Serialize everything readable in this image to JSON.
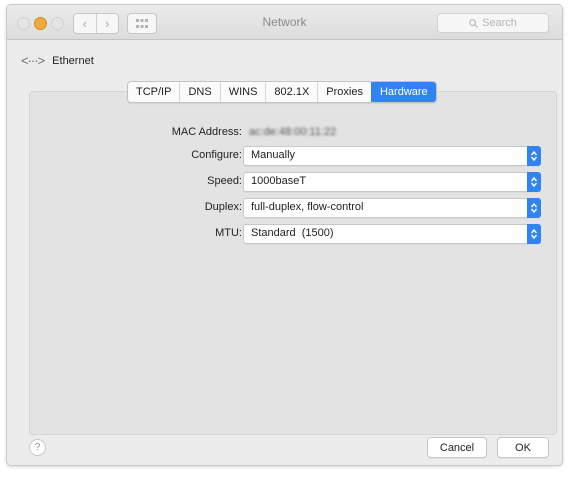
{
  "window": {
    "title": "Network"
  },
  "toolbar": {
    "back_glyph": "‹",
    "forward_glyph": "›",
    "search_placeholder": "Search"
  },
  "header": {
    "back_label": "Ethernet",
    "back_icon": "<···>"
  },
  "tabs": [
    {
      "label": "TCP/IP",
      "active": false
    },
    {
      "label": "DNS",
      "active": false
    },
    {
      "label": "WINS",
      "active": false
    },
    {
      "label": "802.1X",
      "active": false
    },
    {
      "label": "Proxies",
      "active": false
    },
    {
      "label": "Hardware",
      "active": true
    }
  ],
  "hardware": {
    "mac_label": "MAC Address:",
    "mac_value": "ac:de:48:00:11:22",
    "fields": [
      {
        "label": "Configure:",
        "value": "Manually"
      },
      {
        "label": "Speed:",
        "value": "1000baseT"
      },
      {
        "label": "Duplex:",
        "value": "full-duplex, flow-control"
      },
      {
        "label": "MTU:",
        "value": "Standard  (1500)"
      }
    ]
  },
  "footer": {
    "help_glyph": "?",
    "cancel_label": "Cancel",
    "ok_label": "OK"
  },
  "colors": {
    "accent": "#2f84f2",
    "window_bg": "#ececec",
    "panel_bg": "#e3e3e3"
  }
}
